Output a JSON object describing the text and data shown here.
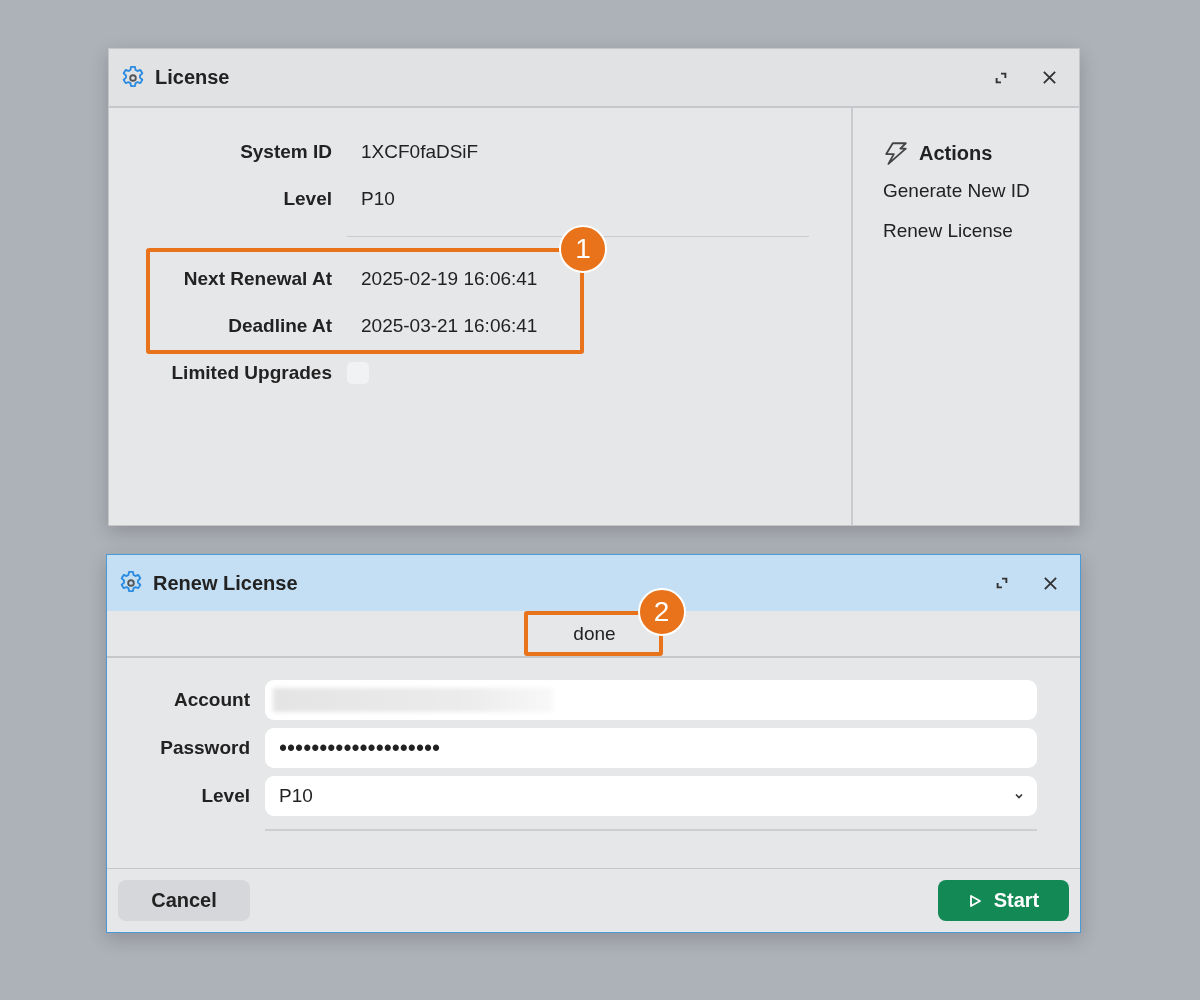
{
  "license_window": {
    "title": "License",
    "groups": [
      {
        "fields": [
          {
            "kind": "text",
            "label": "System ID",
            "value": "1XCF0faDSiF"
          },
          {
            "kind": "text",
            "label": "Level",
            "value": "P10"
          }
        ]
      },
      {
        "divider_before": true,
        "callout": "1",
        "fields": [
          {
            "kind": "text",
            "label": "Next Renewal At",
            "value": "2025-02-19 16:06:41"
          },
          {
            "kind": "text",
            "label": "Deadline At",
            "value": "2025-03-21 16:06:41"
          }
        ]
      },
      {
        "fields": [
          {
            "kind": "checkbox",
            "label": "Limited Upgrades",
            "checked": false
          }
        ]
      }
    ],
    "actions": {
      "title": "Actions",
      "items": [
        "Generate New ID",
        "Renew License"
      ]
    }
  },
  "renew_window": {
    "title": "Renew License",
    "status": {
      "text": "done",
      "callout": "2"
    },
    "fields": [
      {
        "kind": "text",
        "label": "Account",
        "obscured": true
      },
      {
        "kind": "password",
        "label": "Password",
        "value": "••••••••••••••••••••"
      },
      {
        "kind": "select",
        "label": "Level",
        "value": "P10"
      }
    ],
    "buttons": [
      {
        "kind": "secondary",
        "label": "Cancel"
      },
      {
        "kind": "primary",
        "label": "Start"
      }
    ]
  }
}
